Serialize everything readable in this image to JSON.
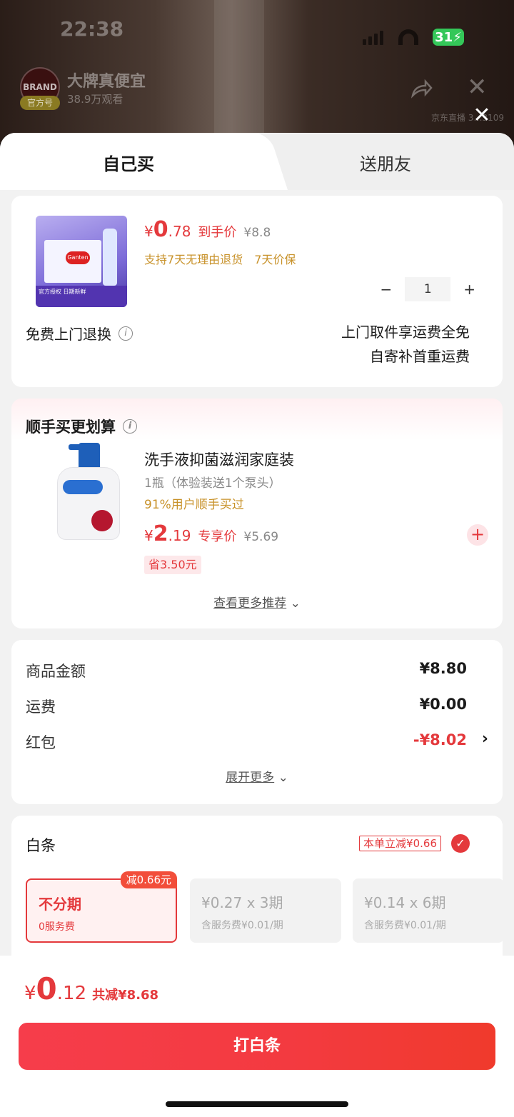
{
  "status_bar": {
    "time": "22:38",
    "battery": "31"
  },
  "live": {
    "avatar_text": "BRAND",
    "badge": "官方号",
    "title": "大牌真便宜",
    "views": "38.9万观看",
    "room_id": "京东直播 3…3109"
  },
  "tabs": [
    {
      "label": "自己买",
      "active": true
    },
    {
      "label": "送朋友",
      "active": false
    }
  ],
  "product": {
    "brand_logo": "Ganten",
    "image_band": "官方授权 日期新鲜",
    "price_yen": "¥",
    "price_int": "0",
    "price_dec": ".78",
    "price_label": "到手价",
    "orig_price": "¥8.8",
    "services": [
      "支持7天无理由退货",
      "7天价保"
    ],
    "quantity": "1",
    "minus": "−",
    "plus": "+"
  },
  "returns": {
    "label": "免费上门退换",
    "note_line1": "上门取件享运费全免",
    "note_line2": "自寄补首重运费"
  },
  "addon": {
    "title": "顺手买更划算",
    "name": "洗手液抑菌滋润家庭装",
    "spec": "1瓶（体验装送1个泵头）",
    "buy_pct": "91%用户顺手买过",
    "price_yen": "¥",
    "price_int": "2",
    "price_dec": ".19",
    "price_label": "专享价",
    "orig_price": "¥5.69",
    "save": "省3.50元",
    "more": "查看更多推荐"
  },
  "summary": {
    "rows": [
      {
        "label": "商品金额",
        "value": "¥8.80"
      },
      {
        "label": "运费",
        "value": "¥0.00"
      },
      {
        "label": "红包",
        "value": "-¥8.02"
      }
    ],
    "expand": "展开更多"
  },
  "baitiao": {
    "title": "白条",
    "promo": "本单立减¥0.66",
    "plans": [
      {
        "title": "不分期",
        "sub": "0服务费",
        "badge": "减0.66元",
        "selected": true
      },
      {
        "title": "¥0.27 x 3期",
        "sub": "含服务费¥0.01/期",
        "selected": false
      },
      {
        "title": "¥0.14 x 6期",
        "sub": "含服务费¥0.01/期",
        "selected": false
      }
    ]
  },
  "footer": {
    "total_yen": "¥",
    "total_int": "0",
    "total_dec": ".12",
    "total_discount": "共减¥8.68",
    "pay_button": "打白条"
  },
  "colors": {
    "accent": "#e4393c",
    "gold": "#c8922a",
    "success": "#34c759"
  }
}
